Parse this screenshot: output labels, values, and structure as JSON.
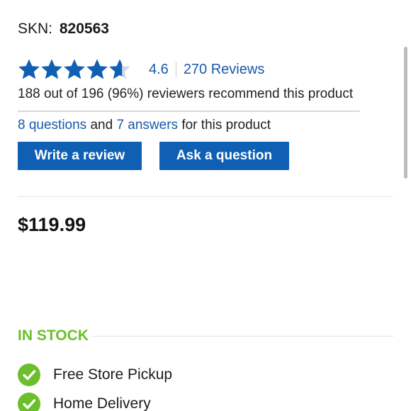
{
  "product": {
    "skn_label": "SKN:",
    "skn_value": "820563"
  },
  "rating": {
    "stars": 4.6,
    "value_text": "4.6",
    "reviews_text": "270 Reviews",
    "recommend_text": "188 out of 196 (96%) reviewers recommend this product",
    "star_color": "#0f5fb3",
    "star_empty_color": "#cfd9e6"
  },
  "qa": {
    "questions_link": "8 questions",
    "and_text": " and ",
    "answers_link": "7 answers",
    "suffix_text": " for this product"
  },
  "actions": {
    "write_review_label": "Write a review",
    "ask_question_label": "Ask a question"
  },
  "price": {
    "text": "$119.99"
  },
  "availability": {
    "status_text": "IN STOCK",
    "status_color": "#6cbf2a",
    "options": [
      {
        "label": "Free Store Pickup",
        "icon": "check-circle-icon"
      },
      {
        "label": "Home Delivery",
        "icon": "check-circle-icon"
      }
    ]
  }
}
